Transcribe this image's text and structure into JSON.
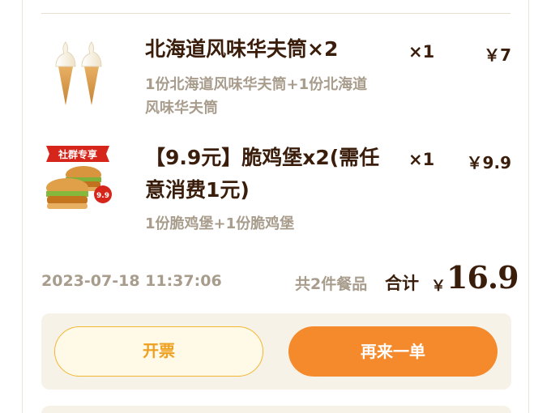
{
  "items": [
    {
      "name": "北海道风味华夫筒×2",
      "desc_line1": "1份北海道风味华夫筒+1份北海道",
      "desc_line2": "风味华夫筒",
      "qty": "×1",
      "price": "￥7",
      "image_icon": "ice-cream-cones-icon"
    },
    {
      "name_line1": "【9.9元】脆鸡堡x2(需任",
      "name_line2": "意消费1元)",
      "desc": "1份脆鸡堡+1份脆鸡堡",
      "qty": "×1",
      "price": "￥9.9",
      "badge": "社群专享",
      "price_tag": "9.9",
      "image_icon": "chicken-burgers-icon"
    }
  ],
  "summary": {
    "timestamp": "2023-07-18 11:37:06",
    "count": "共2件餐品",
    "total_label": "合计",
    "currency": "￥",
    "total": "16.9"
  },
  "actions": {
    "invoice_label": "开票",
    "reorder_label": "再来一单"
  },
  "colors": {
    "brand_orange": "#f48a2b",
    "invoice_accent": "#f0a020",
    "text_dark": "#3a1d0a",
    "text_muted": "#a89c8c",
    "panel_bg": "#f7f2e8"
  }
}
